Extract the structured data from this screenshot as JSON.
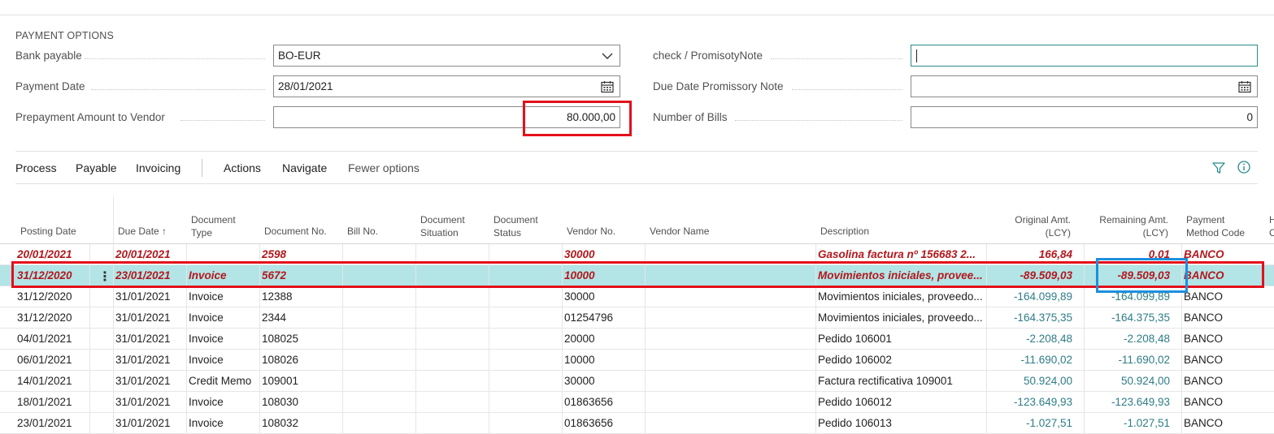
{
  "section_title": "PAYMENT OPTIONS",
  "fields": {
    "bank_payable": {
      "label": "Bank payable",
      "value": "BO-EUR"
    },
    "payment_date": {
      "label": "Payment Date",
      "value": "28/01/2021"
    },
    "prepayment_amount": {
      "label": "Prepayment Amount to Vendor",
      "value": "80.000,00"
    },
    "check_note": {
      "label": "check / PromisotyNote",
      "value": ""
    },
    "due_date_note": {
      "label": "Due Date Promissory Note",
      "value": ""
    },
    "number_of_bills": {
      "label": "Number of Bills",
      "value": "0"
    }
  },
  "actions": {
    "process": "Process",
    "payable": "Payable",
    "invoicing": "Invoicing",
    "actions": "Actions",
    "navigate": "Navigate",
    "fewer_options": "Fewer options"
  },
  "icons": {
    "filter": "filter-icon",
    "info": "info-icon",
    "calendar": "calendar-icon",
    "chevron": "chevron-down-icon"
  },
  "columns": {
    "posting_date": "Posting Date",
    "due_date": "Due Date ↑",
    "document_type_1": "Document",
    "document_type_2": "Type",
    "document_no": "Document No.",
    "bill_no": "Bill No.",
    "doc_situation_1": "Document",
    "doc_situation_2": "Situation",
    "doc_status_1": "Document",
    "doc_status_2": "Status",
    "vendor_no": "Vendor No.",
    "vendor_name": "Vendor Name",
    "description": "Description",
    "original_amt_1": "Original Amt.",
    "original_amt_2": "(LCY)",
    "remaining_amt_1": "Remaining Amt.",
    "remaining_amt_2": "(LCY)",
    "payment_method_1": "Payment",
    "payment_method_2": "Method Code",
    "cut_1": "H",
    "cut_2": "C"
  },
  "rows": [
    {
      "posting_date": "20/01/2021",
      "due_date": "20/01/2021",
      "doc_type": "",
      "doc_no": "2598",
      "vendor_no": "30000",
      "description": "Gasolina factura nº 156683 2...",
      "original": "166,84",
      "remaining": "0,01",
      "method": "BANCO"
    },
    {
      "posting_date": "31/12/2020",
      "due_date": "23/01/2021",
      "doc_type": "Invoice",
      "doc_no": "5672",
      "vendor_no": "10000",
      "description": "Movimientos iniciales, provee...",
      "original": "-89.509,03",
      "remaining": "-89.509,03",
      "method": "BANCO"
    },
    {
      "posting_date": "31/12/2020",
      "due_date": "31/01/2021",
      "doc_type": "Invoice",
      "doc_no": "12388",
      "vendor_no": "30000",
      "description": "Movimientos iniciales, proveedo...",
      "original": "-164.099,89",
      "remaining": "-164.099,89",
      "method": "BANCO"
    },
    {
      "posting_date": "31/12/2020",
      "due_date": "31/01/2021",
      "doc_type": "Invoice",
      "doc_no": "2344",
      "vendor_no": "01254796",
      "description": "Movimientos iniciales, proveedo...",
      "original": "-164.375,35",
      "remaining": "-164.375,35",
      "method": "BANCO"
    },
    {
      "posting_date": "04/01/2021",
      "due_date": "31/01/2021",
      "doc_type": "Invoice",
      "doc_no": "108025",
      "vendor_no": "20000",
      "description": "Pedido 106001",
      "original": "-2.208,48",
      "remaining": "-2.208,48",
      "method": "BANCO"
    },
    {
      "posting_date": "06/01/2021",
      "due_date": "31/01/2021",
      "doc_type": "Invoice",
      "doc_no": "108026",
      "vendor_no": "10000",
      "description": "Pedido 106002",
      "original": "-11.690,02",
      "remaining": "-11.690,02",
      "method": "BANCO"
    },
    {
      "posting_date": "14/01/2021",
      "due_date": "31/01/2021",
      "doc_type": "Credit Memo",
      "doc_no": "109001",
      "vendor_no": "30000",
      "description": "Factura rectificativa 109001",
      "original": "50.924,00",
      "remaining": "50.924,00",
      "method": "BANCO"
    },
    {
      "posting_date": "18/01/2021",
      "due_date": "31/01/2021",
      "doc_type": "Invoice",
      "doc_no": "108030",
      "vendor_no": "01863656",
      "description": "Pedido 106012",
      "original": "-123.649,93",
      "remaining": "-123.649,93",
      "method": "BANCO"
    },
    {
      "posting_date": "23/01/2021",
      "due_date": "31/01/2021",
      "doc_type": "Invoice",
      "doc_no": "108032",
      "vendor_no": "01863656",
      "description": "Pedido 106013",
      "original": "-1.027,51",
      "remaining": "-1.027,51",
      "method": "BANCO"
    }
  ]
}
